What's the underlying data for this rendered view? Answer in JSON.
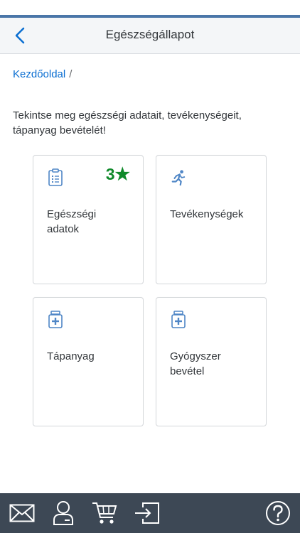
{
  "header": {
    "title": "Egészségállapot",
    "back_icon": "chevron-left-icon"
  },
  "breadcrumb": {
    "home_label": "Kezdőoldal",
    "separator": "/"
  },
  "intro_text": "Tekintse meg egészségi adatait, tevékenységeit, tápanyag bevételét!",
  "tiles": [
    {
      "label_line1": "Egészségi",
      "label_line2": "adatok",
      "icon": "clipboard-icon",
      "badge_count": "3",
      "badge_star": "★"
    },
    {
      "label_line1": "Tevékenységek",
      "label_line2": "",
      "icon": "running-person-icon"
    },
    {
      "label_line1": "Tápanyag",
      "label_line2": "",
      "icon": "medicine-bottle-icon"
    },
    {
      "label_line1": "Gyógyszer",
      "label_line2": "bevétel",
      "icon": "medicine-bottle-icon"
    }
  ],
  "footer": {
    "icons": [
      "mail-icon",
      "user-icon",
      "cart-icon",
      "sign-in-icon",
      "help-icon"
    ]
  },
  "colors": {
    "accent": "#4a76a8",
    "link": "#0a6ed1",
    "icon": "#4f86c6",
    "badge": "#0f8a2a",
    "footer_bg": "#3d4855"
  }
}
